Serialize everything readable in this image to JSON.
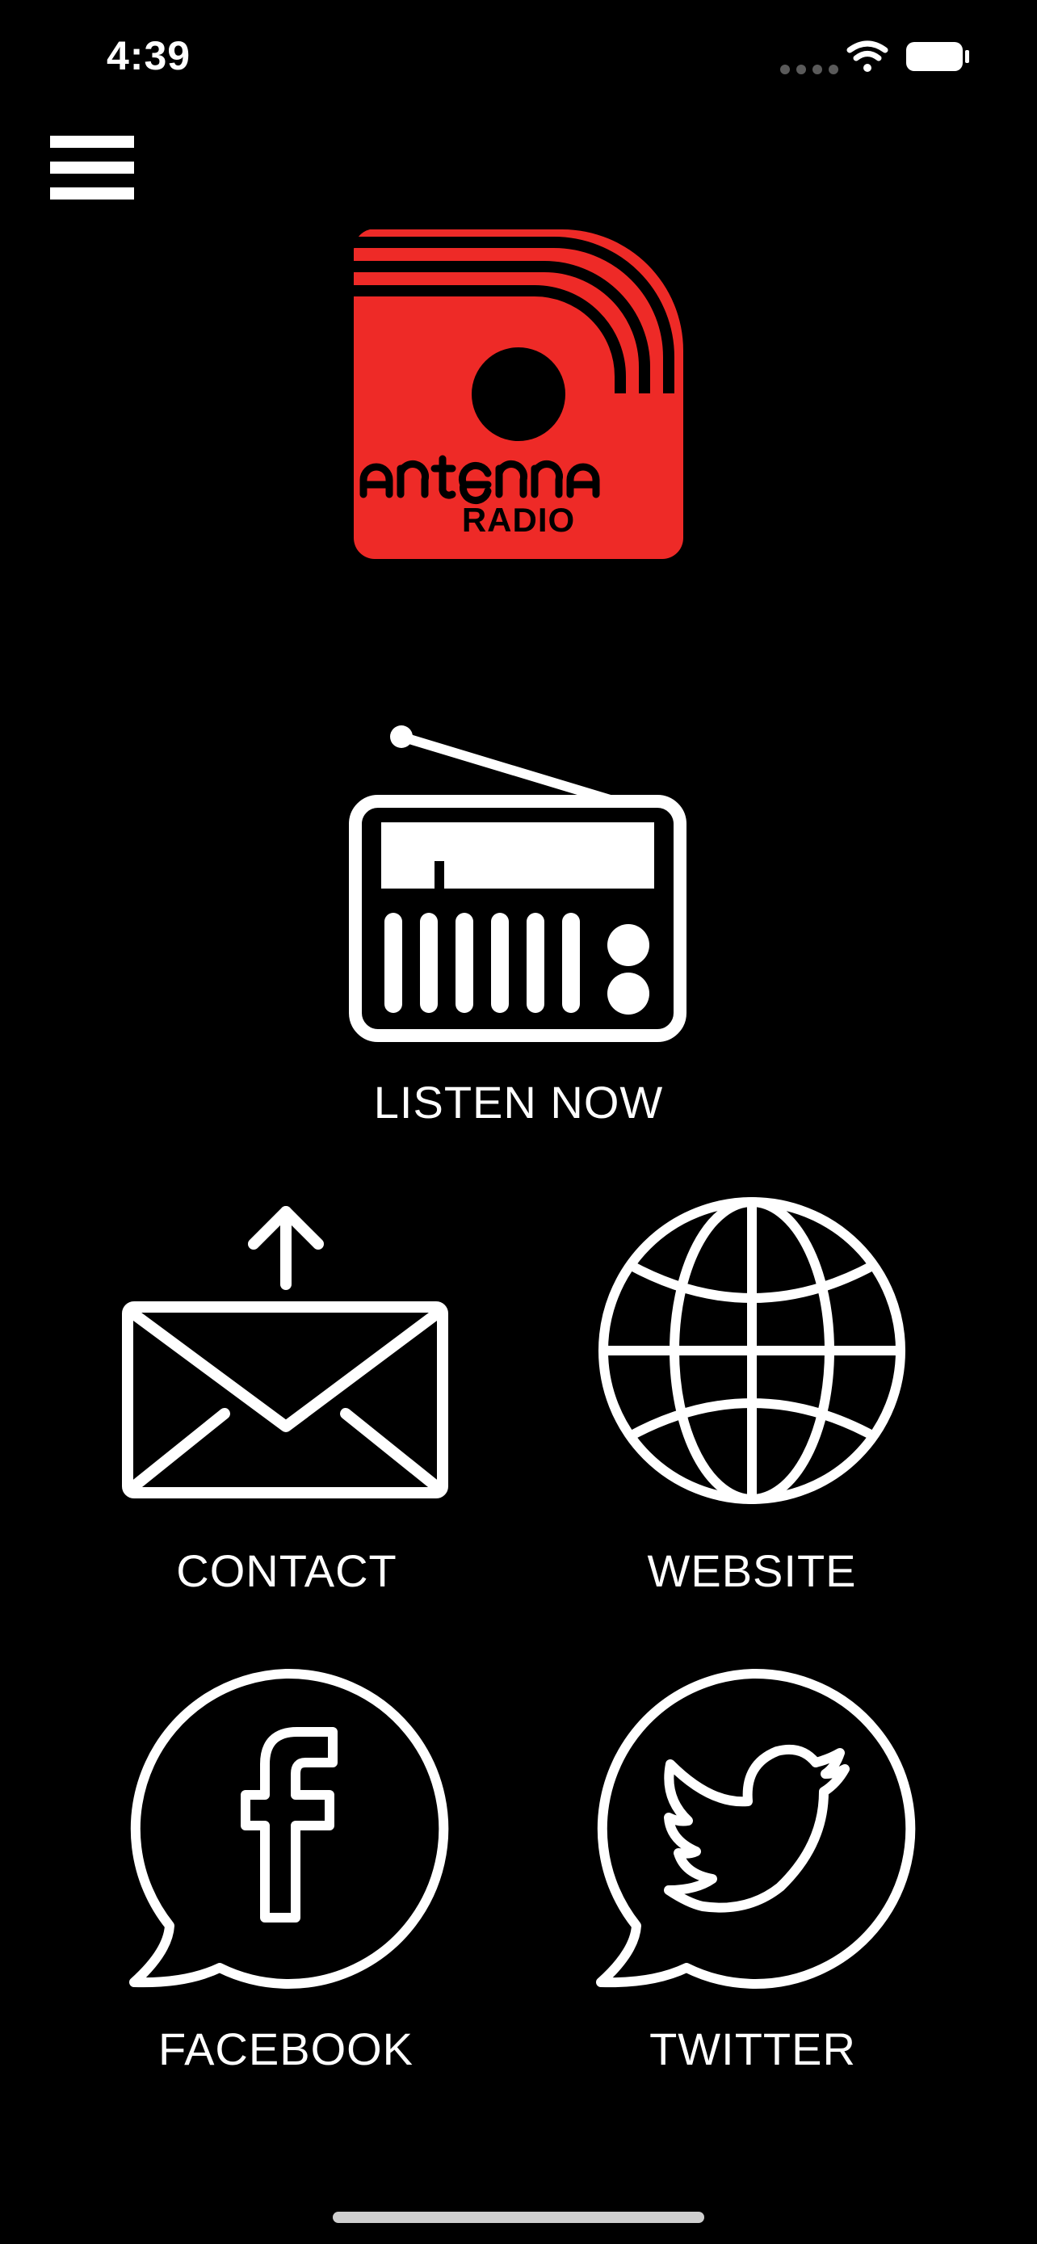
{
  "status_bar": {
    "time": "4:39",
    "signal_icon": "signal-dots-icon",
    "wifi_icon": "wifi-icon",
    "battery_icon": "battery-icon"
  },
  "menu": {
    "icon": "hamburger-menu-icon"
  },
  "logo": {
    "brand": "Antenna",
    "subtitle": "RADIO",
    "color": "#ee2a27"
  },
  "tiles": {
    "listen": {
      "label": "LISTEN NOW",
      "icon": "radio-icon"
    },
    "contact": {
      "label": "CONTACT",
      "icon": "envelope-upload-icon"
    },
    "website": {
      "label": "WEBSITE",
      "icon": "globe-icon"
    },
    "facebook": {
      "label": "FACEBOOK",
      "icon": "facebook-bubble-icon"
    },
    "twitter": {
      "label": "TWITTER",
      "icon": "twitter-bubble-icon"
    }
  },
  "colors": {
    "background": "#000000",
    "foreground": "#ffffff",
    "accent": "#ee2a27"
  }
}
